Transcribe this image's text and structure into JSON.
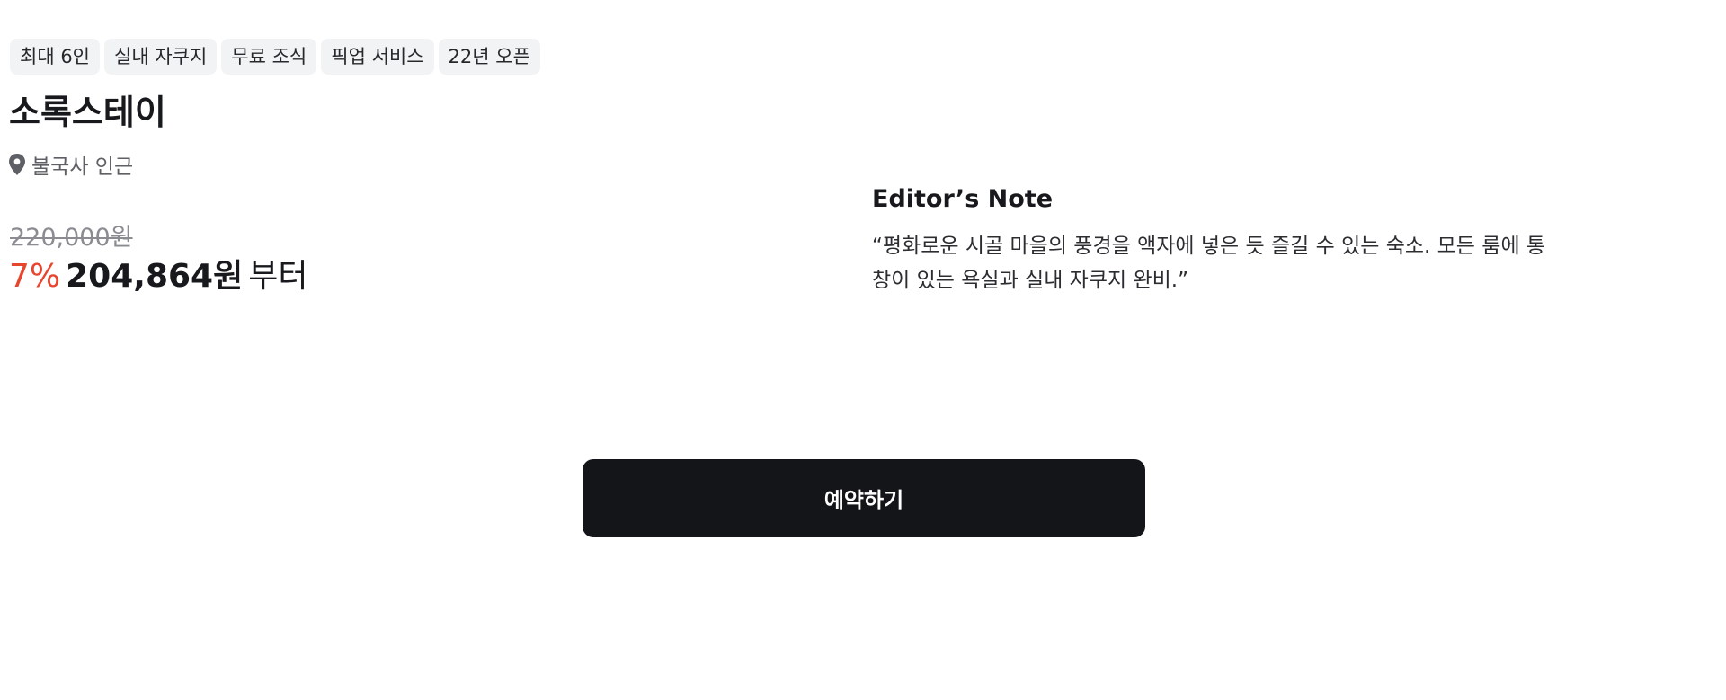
{
  "tags": [
    "최대 6인",
    "실내 자쿠지",
    "무료 조식",
    "픽업 서비스",
    "22년 오픈"
  ],
  "title": "소록스테이",
  "location": {
    "icon": "location-pin-icon",
    "text": "불국사 인근"
  },
  "pricing": {
    "original_price": "220,000원",
    "discount": "7%",
    "price": "204,864원",
    "price_suffix": "부터"
  },
  "editor_note": {
    "title": "Editor’s Note",
    "text": "“평화로운 시골 마을의 풍경을 액자에 넣은 듯 즐길 수 있는 숙소. 모든 룸에 통창이 있는 욕실과 실내 자쿠지 완비.”"
  },
  "cta": {
    "reserve_label": "예약하기"
  },
  "colors": {
    "discount": "#e8452f",
    "button_bg": "#131519",
    "tag_bg": "#f2f3f5"
  }
}
